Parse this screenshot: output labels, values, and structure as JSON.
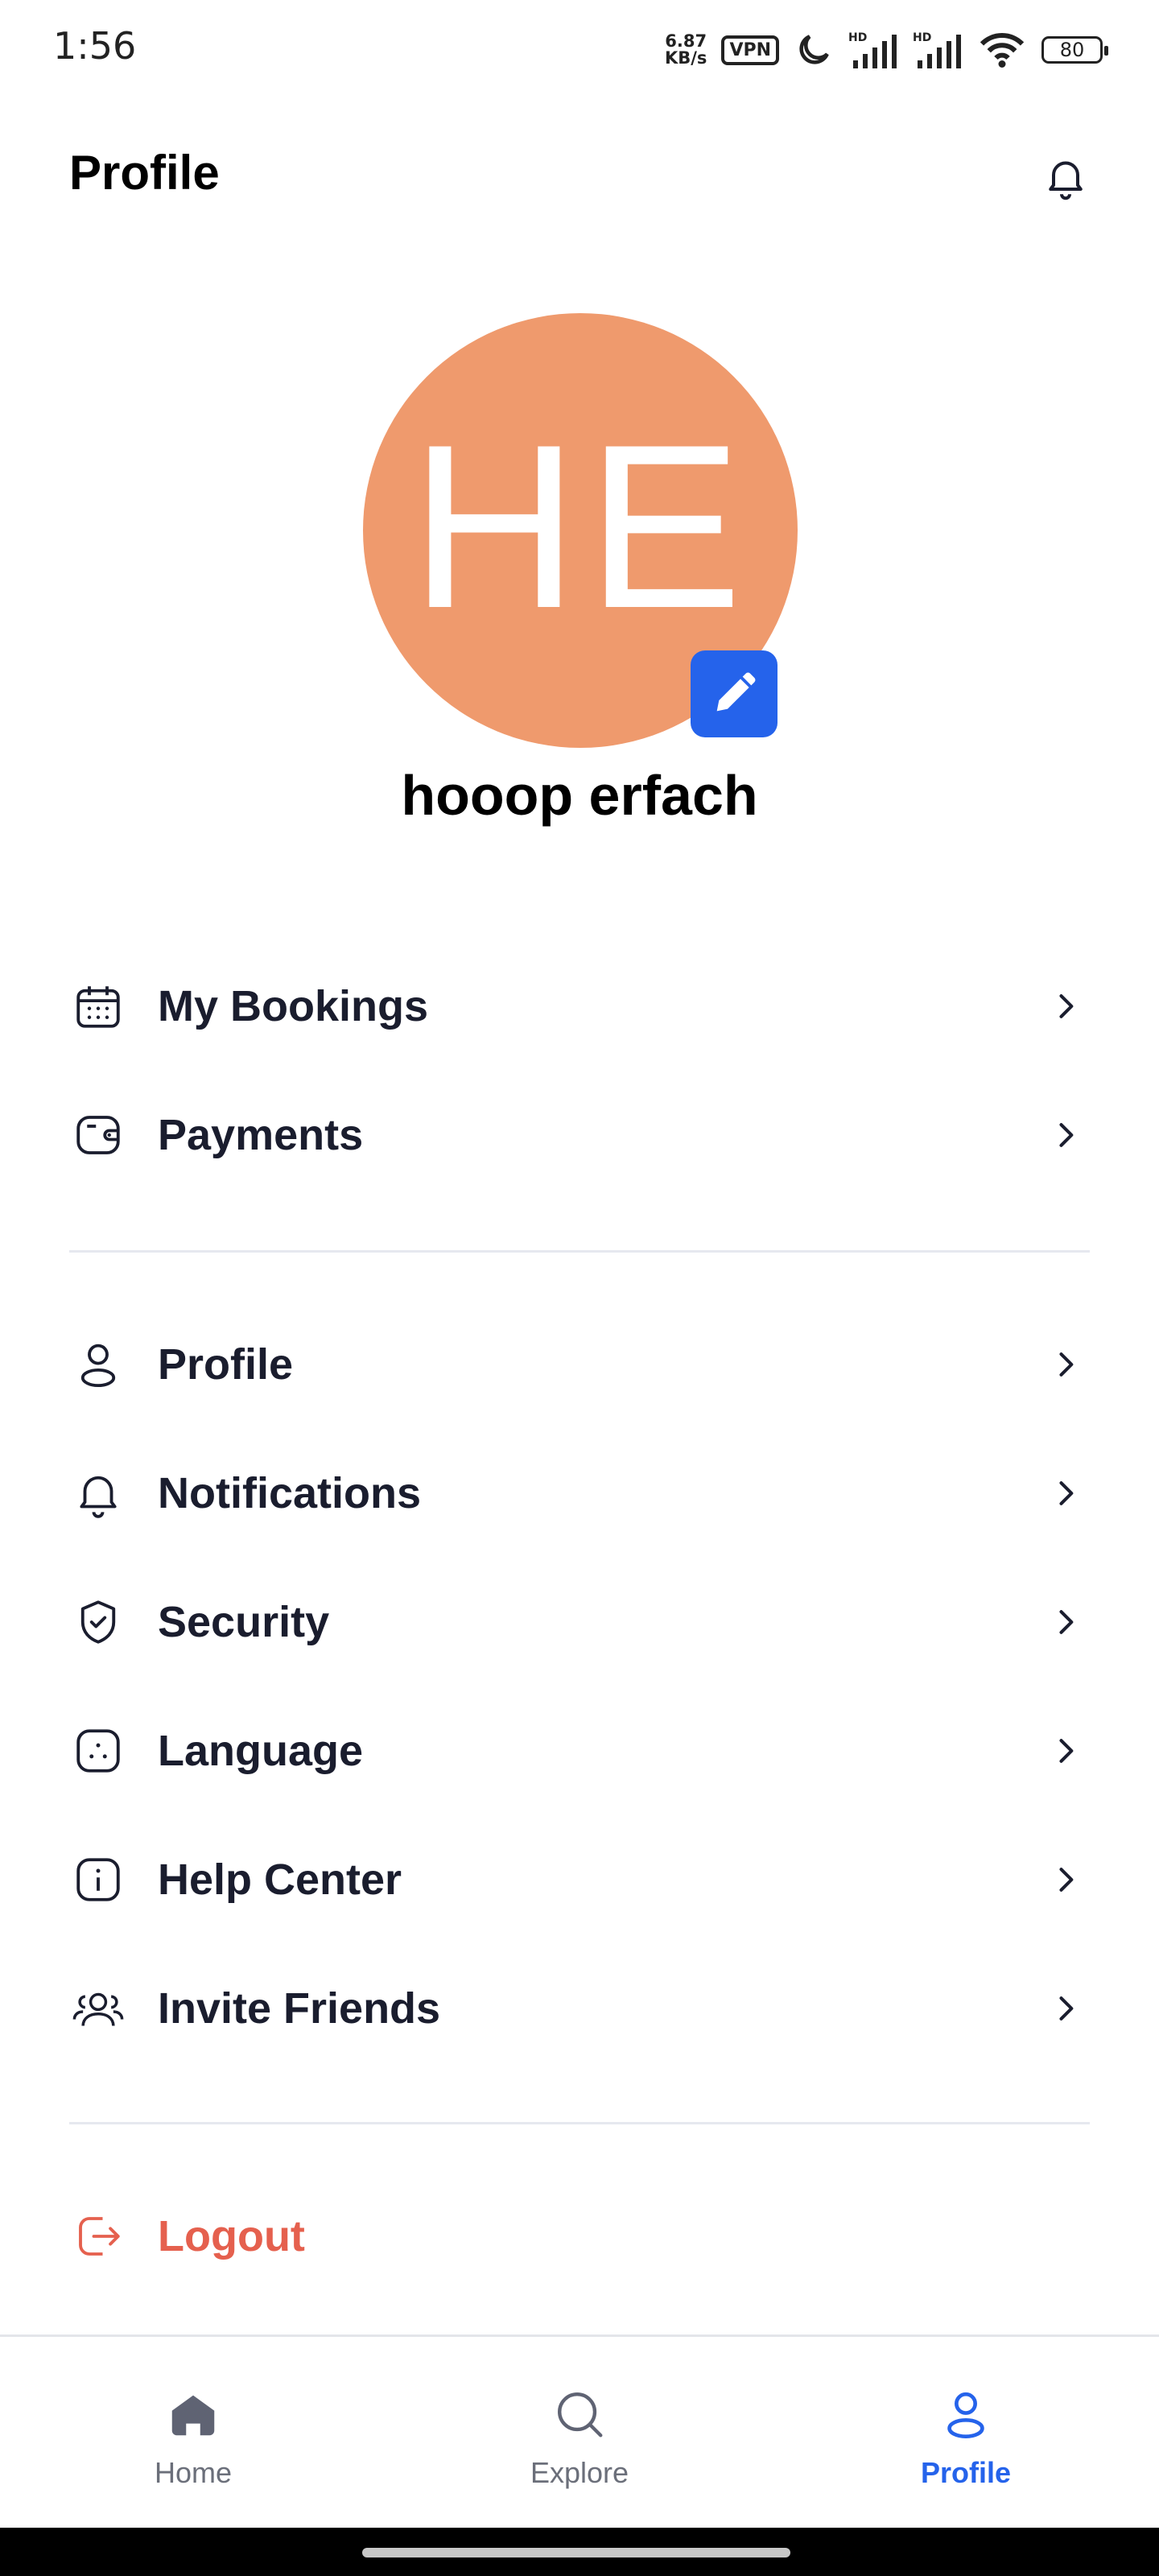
{
  "status_bar": {
    "time": "1:56",
    "net_speed_value": "6.87",
    "net_speed_unit": "KB/s",
    "vpn": "VPN",
    "battery": "80"
  },
  "header": {
    "title": "Profile"
  },
  "profile": {
    "initials": "HE",
    "name": "hooop erfach",
    "avatar_color": "#ef9a6d"
  },
  "menu": {
    "group1": [
      {
        "label": "My Bookings",
        "icon": "calendar-icon"
      },
      {
        "label": "Payments",
        "icon": "wallet-icon"
      }
    ],
    "group2": [
      {
        "label": "Profile",
        "icon": "user-icon"
      },
      {
        "label": "Notifications",
        "icon": "bell-icon"
      },
      {
        "label": "Security",
        "icon": "shield-icon"
      },
      {
        "label": "Language",
        "icon": "language-icon"
      },
      {
        "label": "Help Center",
        "icon": "info-icon"
      },
      {
        "label": "Invite Friends",
        "icon": "users-icon"
      }
    ],
    "logout": {
      "label": "Logout",
      "icon": "logout-icon",
      "color": "#e5604e"
    }
  },
  "bottom_nav": {
    "items": [
      {
        "label": "Home",
        "icon": "home-icon",
        "active": false
      },
      {
        "label": "Explore",
        "icon": "search-icon",
        "active": false
      },
      {
        "label": "Profile",
        "icon": "user-icon",
        "active": true
      }
    ],
    "active_color": "#2563eb"
  }
}
